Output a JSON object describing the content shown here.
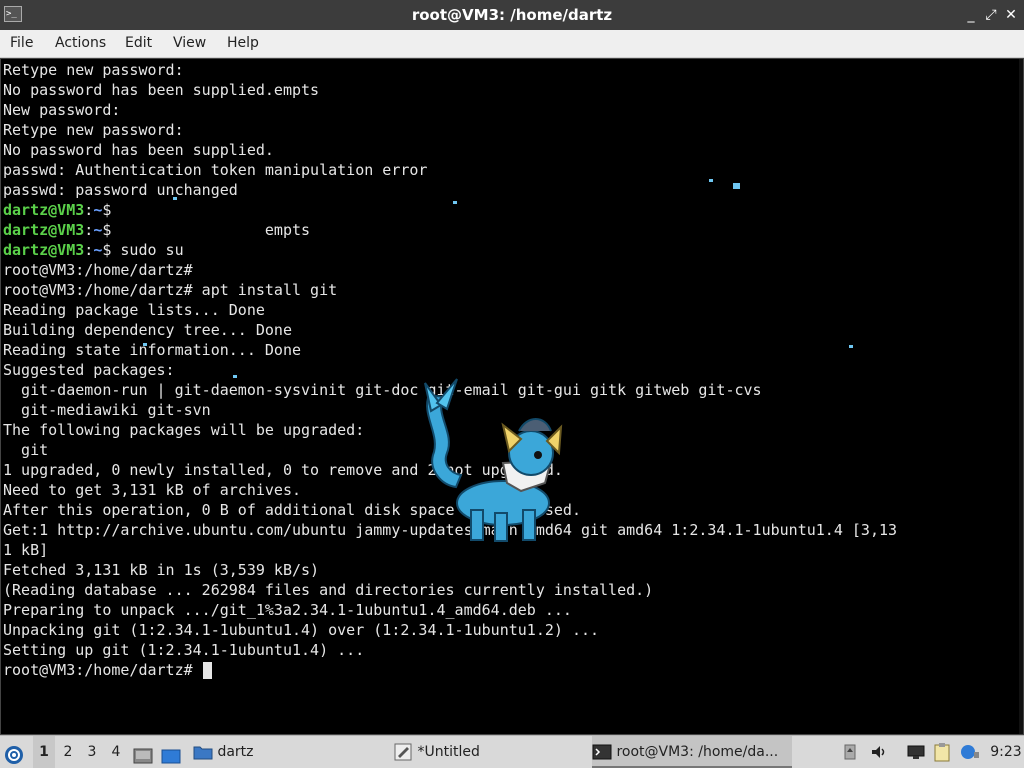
{
  "window": {
    "title": "root@VM3: /home/dartz",
    "controls": [
      "_",
      "⤢",
      "✕"
    ]
  },
  "menu": [
    "File",
    "Actions",
    "Edit",
    "View",
    "Help"
  ],
  "terminal": {
    "lines": [
      {
        "text": "Retype new password:"
      },
      {
        "text": "No password has been supplied.empts"
      },
      {
        "text": "New password:"
      },
      {
        "text": "Retype new password:"
      },
      {
        "text": "No password has been supplied."
      },
      {
        "text": "passwd: Authentication token manipulation error"
      },
      {
        "text": "passwd: password unchanged"
      },
      {
        "prompt_user": "dartz@VM3",
        "prompt_path": "~",
        "prompt_sym": "$",
        "text": ""
      },
      {
        "prompt_user": "dartz@VM3",
        "prompt_path": "~",
        "prompt_sym": "$",
        "text": "                 empts"
      },
      {
        "prompt_user": "dartz@VM3",
        "prompt_path": "~",
        "prompt_sym": "$",
        "text": " sudo su"
      },
      {
        "text": "root@VM3:/home/dartz#"
      },
      {
        "text": "root@VM3:/home/dartz# apt install git"
      },
      {
        "text": "Reading package lists... Done"
      },
      {
        "text": "Building dependency tree... Done"
      },
      {
        "text": "Reading state information... Done"
      },
      {
        "text": "Suggested packages:"
      },
      {
        "text": "  git-daemon-run | git-daemon-sysvinit git-doc git-email git-gui gitk gitweb git-cvs"
      },
      {
        "text": "  git-mediawiki git-svn"
      },
      {
        "text": "The following packages will be upgraded:"
      },
      {
        "text": "  git"
      },
      {
        "text": "1 upgraded, 0 newly installed, 0 to remove and 2 not upgraded."
      },
      {
        "text": "Need to get 3,131 kB of archives."
      },
      {
        "text": "After this operation, 0 B of additional disk space will be used."
      },
      {
        "text": "Get:1 http://archive.ubuntu.com/ubuntu jammy-updates/main amd64 git amd64 1:2.34.1-1ubuntu1.4 [3,13"
      },
      {
        "text": "1 kB]"
      },
      {
        "text": "Fetched 3,131 kB in 1s (3,539 kB/s)"
      },
      {
        "text": "(Reading database ... 262984 files and directories currently installed.)"
      },
      {
        "text": "Preparing to unpack .../git_1%3a2.34.1-1ubuntu1.4_amd64.deb ..."
      },
      {
        "text": "Unpacking git (1:2.34.1-1ubuntu1.4) over (1:2.34.1-1ubuntu1.2) ..."
      },
      {
        "text": "Setting up git (1:2.34.1-1ubuntu1.4) ..."
      },
      {
        "text": "root@VM3:/home/dartz# ",
        "cursor": true
      }
    ]
  },
  "taskbar": {
    "workspaces": [
      "1",
      "2",
      "3",
      "4"
    ],
    "folder_label": "dartz",
    "tasks": [
      {
        "label": "*Untitled"
      },
      {
        "label": "root@VM3: /home/da..."
      }
    ],
    "clock": "9:23"
  }
}
